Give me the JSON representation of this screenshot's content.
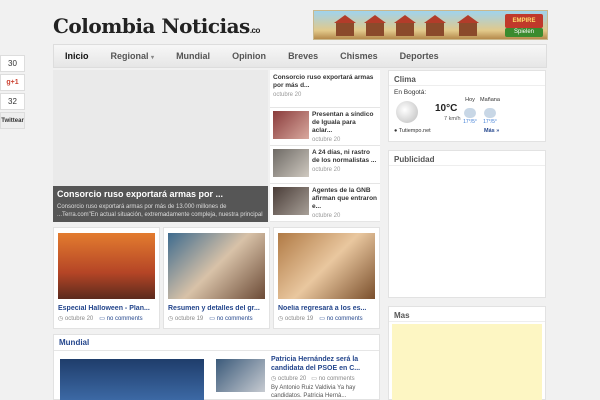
{
  "share": {
    "fb_count": "30",
    "gplus": "g+1",
    "gplus_count": "32",
    "tweet": "Twittear"
  },
  "site": {
    "logo": "Colombia Noticias",
    "logo_suffix": ".co"
  },
  "banner": {
    "title": "EMPIRE",
    "cta": "Spielen"
  },
  "nav": {
    "items": [
      "Inicio",
      "Regional",
      "Mundial",
      "Opinion",
      "Breves",
      "Chismes",
      "Deportes"
    ],
    "dropdown_caret": "▾"
  },
  "featured": {
    "title": "Consorcio ruso exportará armas por ...",
    "excerpt": "Consorcio ruso exportará armas por más de 13.000 millones de ...Terra.com\"En actual situación, extremadamente compleja, nuestra principal"
  },
  "side_list": {
    "top": {
      "title": "Consorcio ruso exportará armas por más d...",
      "date": "octubre 20"
    },
    "items": [
      {
        "title": "Presentan a síndico de Iguala para aclar...",
        "date": "octubre 20"
      },
      {
        "title": "A 24 días, ni rastro de los normalistas ...",
        "date": "octubre 20"
      },
      {
        "title": "Agentes de la GNB afirman que entraron e...",
        "date": "octubre 20"
      }
    ]
  },
  "cards": [
    {
      "title": "Especial Halloween - Plan...",
      "date": "octubre 20",
      "comments": "no comments"
    },
    {
      "title": "Resumen y detalles del gr...",
      "date": "octubre 19",
      "comments": "no comments"
    },
    {
      "title": "Noelia regresará a los es...",
      "date": "octubre 19",
      "comments": "no comments"
    }
  ],
  "mundial": {
    "heading": "Mundial",
    "article": {
      "title": "Patricia Hernández será la candidata del PSOE en C...",
      "date": "octubre 20",
      "comments": "no comments",
      "excerpt": "By Antonio Ruiz Valdivia Ya hay candidatos. Patricia Hernà..."
    }
  },
  "clima": {
    "heading": "Clima",
    "location": "En Bogotá:",
    "temp": "10°C",
    "wind": "7 km/h",
    "today_label": "Hoy",
    "tomorrow_label": "Mañana",
    "today_range": "17°/5°",
    "tomorrow_range": "17°/5°",
    "source": "Tutiempo.net",
    "more": "Más »"
  },
  "publicidad": {
    "heading": "Publicidad"
  },
  "mas": {
    "heading": "Mas"
  }
}
